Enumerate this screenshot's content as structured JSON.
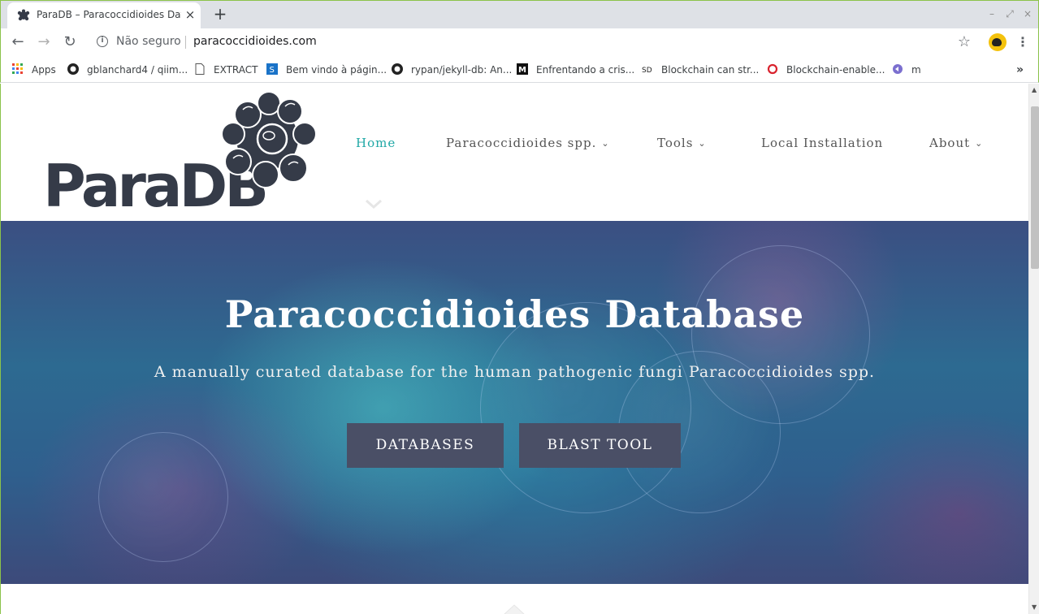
{
  "browser": {
    "tab_title": "ParaDB – Paracoccidioides Database",
    "tab_close": "×",
    "new_tab": "+",
    "back_icon": "←",
    "forward_icon": "→",
    "reload_icon": "↻",
    "security_label": "Não seguro",
    "url": "paracoccidioides.com",
    "star_icon": "☆",
    "menu_icon": "⋮",
    "bookmarks": [
      {
        "label": "Apps",
        "icon": "apps-grid-icon"
      },
      {
        "label": "gblanchard4 / qiim...",
        "icon": "github-icon"
      },
      {
        "label": "EXTRACT",
        "icon": "page-icon"
      },
      {
        "label": "Bem vindo à págin...",
        "icon": "s-icon"
      },
      {
        "label": "rypan/jekyll-db: An...",
        "icon": "github-icon"
      },
      {
        "label": "Enfrentando a cris...",
        "icon": "medium-icon"
      },
      {
        "label": "Blockchain can str...",
        "icon": "sd-icon"
      },
      {
        "label": "Blockchain-enable...",
        "icon": "o-icon"
      },
      {
        "label": "m",
        "icon": "m-icon"
      }
    ],
    "bookmarks_more": "»"
  },
  "site": {
    "logo_text": "ParaDB",
    "nav": [
      {
        "label": "Home",
        "active": true
      },
      {
        "label": "Paracoccidioides spp.",
        "dropdown": true
      },
      {
        "label": "Tools",
        "dropdown": true
      },
      {
        "label": "Local Installation"
      },
      {
        "label": "About",
        "dropdown": true
      }
    ],
    "chevron": "⌄",
    "hero": {
      "title": "Paracoccidioides Database",
      "subtitle": "A manually curated database for the human pathogenic fungi Paracoccidioides spp.",
      "buttons": [
        "DATABASES",
        "BLAST TOOL"
      ]
    }
  },
  "colors": {
    "accent": "#20a8a6",
    "nav_text": "#555555",
    "logo": "#353b48",
    "button_bg": "#4a4f66"
  }
}
